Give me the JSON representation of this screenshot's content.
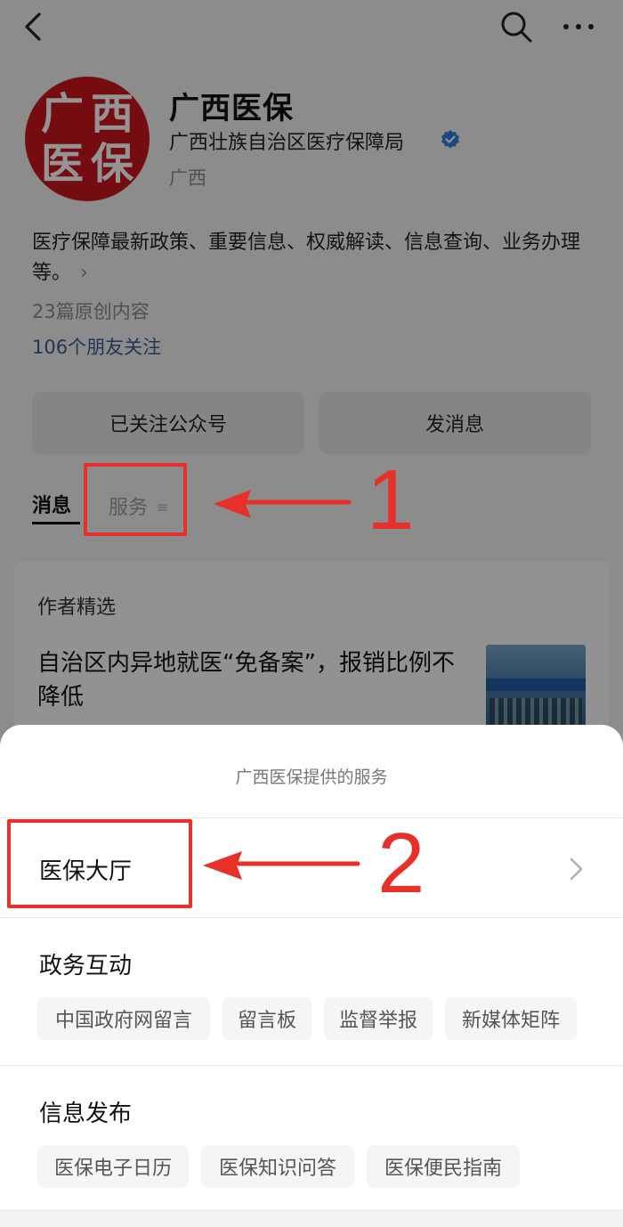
{
  "nav": {
    "back_icon": "chevron-left-icon",
    "search_icon": "search-icon",
    "more_icon": "more-dots-icon"
  },
  "profile": {
    "avatar_chars": [
      "广",
      "西",
      "医",
      "保"
    ],
    "name": "广西医保",
    "org": "广西壮族自治区医疗保障局",
    "region": "广西",
    "description": "医疗保障最新政策、重要信息、权威解读、信息查询、业务办理等。",
    "original_count": "23篇原创内容",
    "friends_following": "106个朋友关注"
  },
  "actions": {
    "follow_label": "已关注公众号",
    "message_label": "发消息"
  },
  "tabs": {
    "messages": "消息",
    "services": "服务"
  },
  "featured": {
    "header": "作者精选",
    "article_title": "自治区内异地就医“免备案”，报销比例不降低"
  },
  "annotations": {
    "step1": "1",
    "step2": "2",
    "color": "#e8302a"
  },
  "service_sheet": {
    "title": "广西医保提供的服务",
    "hall": "医保大厅",
    "sections": [
      {
        "title": "政务互动",
        "chips": [
          "中国政府网留言",
          "留言板",
          "监督举报",
          "新媒体矩阵"
        ]
      },
      {
        "title": "信息发布",
        "chips": [
          "医保电子日历",
          "医保知识问答",
          "医保便民指南"
        ]
      }
    ]
  },
  "colors": {
    "avatar_red": "#c8161d",
    "link_blue": "#3b5b8f",
    "verified_blue": "#2f7de1"
  }
}
